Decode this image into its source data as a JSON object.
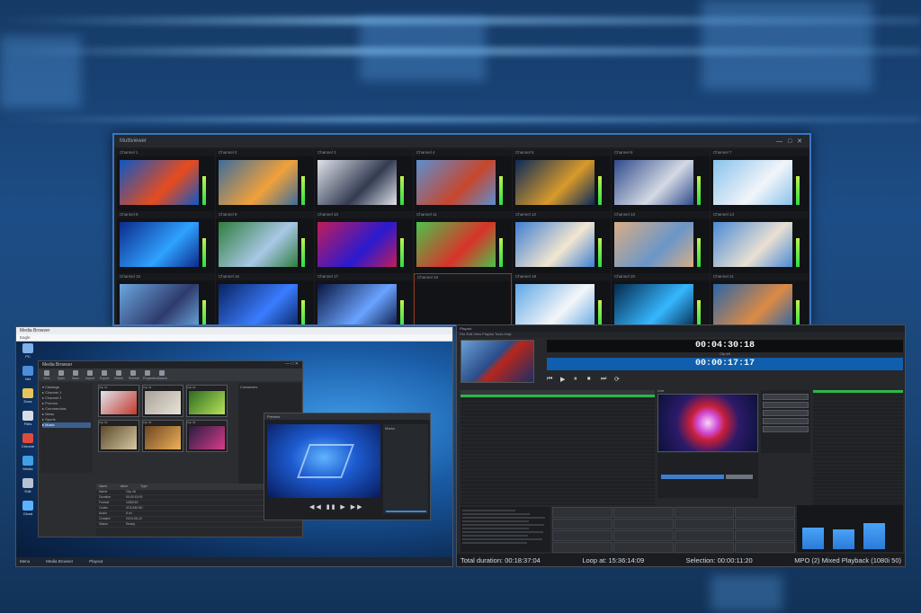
{
  "multiviewer": {
    "title": "Multiviewer",
    "controls": "— □ ✕",
    "tiles": [
      {
        "label": "Channel 1",
        "video": [
          "#0c57c7",
          "#e84c1d"
        ]
      },
      {
        "label": "Channel 2",
        "video": [
          "#3c6d9c",
          "#f1a13a"
        ]
      },
      {
        "label": "Channel 3",
        "video": [
          "#dfe3ea",
          "#333b52"
        ]
      },
      {
        "label": "Channel 4",
        "video": [
          "#5b8fd0",
          "#c8462d"
        ]
      },
      {
        "label": "Channel 5",
        "video": [
          "#0b2a5a",
          "#d89a2a"
        ]
      },
      {
        "label": "Channel 6",
        "video": [
          "#2f4b8c",
          "#d4d9e4"
        ]
      },
      {
        "label": "Channel 7",
        "video": [
          "#88c2ec",
          "#f2f5f9"
        ]
      },
      {
        "label": "Channel 8",
        "video": [
          "#0d2b8c",
          "#2fa2ff"
        ]
      },
      {
        "label": "Channel 9",
        "video": [
          "#2f7d3e",
          "#a9c8e6"
        ]
      },
      {
        "label": "Channel 10",
        "video": [
          "#c21c5a",
          "#2a1ad0"
        ]
      },
      {
        "label": "Channel 11",
        "video": [
          "#4dc24b",
          "#d9322a"
        ]
      },
      {
        "label": "Channel 12",
        "video": [
          "#3f7fd2",
          "#f2e6d0"
        ]
      },
      {
        "label": "Channel 13",
        "video": [
          "#d8ae84",
          "#6a96c9"
        ]
      },
      {
        "label": "Channel 14",
        "video": [
          "#4a8ad6",
          "#e9e0d2"
        ]
      },
      {
        "label": "Channel 15",
        "video": [
          "#6aa7df",
          "#2f3a6c"
        ]
      },
      {
        "label": "Channel 16",
        "video": [
          "#0a2360",
          "#3a7dff"
        ]
      },
      {
        "label": "Channel 17",
        "video": [
          "#0a1640",
          "#6aa3ff"
        ]
      },
      {
        "label": "Channel 18",
        "video": null
      },
      {
        "label": "Channel 19",
        "video": [
          "#5fa7e6",
          "#f4f6f8"
        ]
      },
      {
        "label": "Channel 20",
        "video": [
          "#032a4c",
          "#36b7ff"
        ]
      },
      {
        "label": "Channel 21",
        "video": [
          "#2a65a8",
          "#dc8a45"
        ]
      }
    ]
  },
  "desktop": {
    "window_title": "Media Browser",
    "address": "Eagle",
    "sidebar": [
      {
        "label": "PC",
        "icon": "computer-icon",
        "color": "#7fb0e8"
      },
      {
        "label": "Net",
        "icon": "network-icon",
        "color": "#4d8fd8"
      },
      {
        "label": "Docs",
        "icon": "folder-icon",
        "color": "#e9c45a"
      },
      {
        "label": "Files",
        "icon": "file-icon",
        "color": "#d9dee6"
      },
      {
        "label": "Chrome",
        "icon": "browser-icon",
        "color": "#e04a3b"
      },
      {
        "label": "Media",
        "icon": "media-icon",
        "color": "#3fa0e8"
      },
      {
        "label": "Edit",
        "icon": "edit-icon",
        "color": "#b7c3d3"
      },
      {
        "label": "Cloud",
        "icon": "cloud-icon",
        "color": "#5ab4ff"
      }
    ],
    "taskbar": [
      "Menu",
      "Media Browser",
      "Playout"
    ]
  },
  "media_browser": {
    "title": "Media Browser",
    "controls": "— □ ✕",
    "toolbar": [
      "New",
      "Open",
      "Save",
      "Import",
      "Export",
      "Delete",
      "Refresh",
      "Properties",
      "Search"
    ],
    "tree": [
      "Catalogs",
      "Channel 1",
      "Channel 2",
      "Promos",
      "Commercials",
      "News",
      "Sports",
      "Music"
    ],
    "tree_selected": 7,
    "thumbs": [
      {
        "label": "Clip 01",
        "colors": [
          "#e0e3ea",
          "#c23a2e"
        ]
      },
      {
        "label": "Clip 02",
        "colors": [
          "#a8a39a",
          "#e9e2d6"
        ]
      },
      {
        "label": "Clip 03",
        "colors": [
          "#2d6b21",
          "#b6e35a"
        ]
      },
      {
        "label": "Clip 04",
        "colors": [
          "#5a4a2c",
          "#d8c9a2"
        ]
      },
      {
        "label": "Clip 05",
        "colors": [
          "#6c4622",
          "#f0b15a"
        ]
      },
      {
        "label": "Clip 06",
        "colors": [
          "#2a1d40",
          "#d63c8a"
        ]
      }
    ],
    "right_title": "Containers",
    "props_header": [
      "Name",
      "Value",
      "Type"
    ],
    "props": [
      [
        "Name",
        "Clip 06"
      ],
      [
        "Duration",
        "00:00:15:00"
      ],
      [
        "Format",
        "1080i 50"
      ],
      [
        "Codec",
        "XDCAM HD"
      ],
      [
        "Audio",
        "8 ch"
      ],
      [
        "Created",
        "2019-05-12"
      ],
      [
        "Status",
        "Ready"
      ]
    ]
  },
  "preview": {
    "title": "Preview",
    "transport": "◀◀ ▮▮ ▶ ▶▶",
    "side_title": "Marks"
  },
  "playout": {
    "title": "Playout",
    "menu": "File  Edit  View  Playlist  Tools  Help",
    "timers": {
      "remaining": "00:04:30:18",
      "remaining_label": "Clip left",
      "elapsed": "00:00:17:17",
      "elapsed_label": "Elapsed"
    },
    "transport": [
      "⏮",
      "▶",
      "⏸",
      "⏹",
      "⏭",
      "⟳"
    ],
    "list_rows": 30,
    "onair_row": 0,
    "files_rows": 30,
    "files_selected": 0,
    "live_label": "Live",
    "ctrl_buttons": 5,
    "log_lines": 10,
    "grid_cells": 16,
    "meters": [
      0.55,
      0.5,
      0.65
    ],
    "status": {
      "total": "Total duration: 00:18:37:04",
      "loop": "Loop at: 15:36:14:09",
      "selection": "Selection: 00:00:11:20",
      "mode": "MPO (2) Mixed Playback (1080i 50)"
    }
  }
}
